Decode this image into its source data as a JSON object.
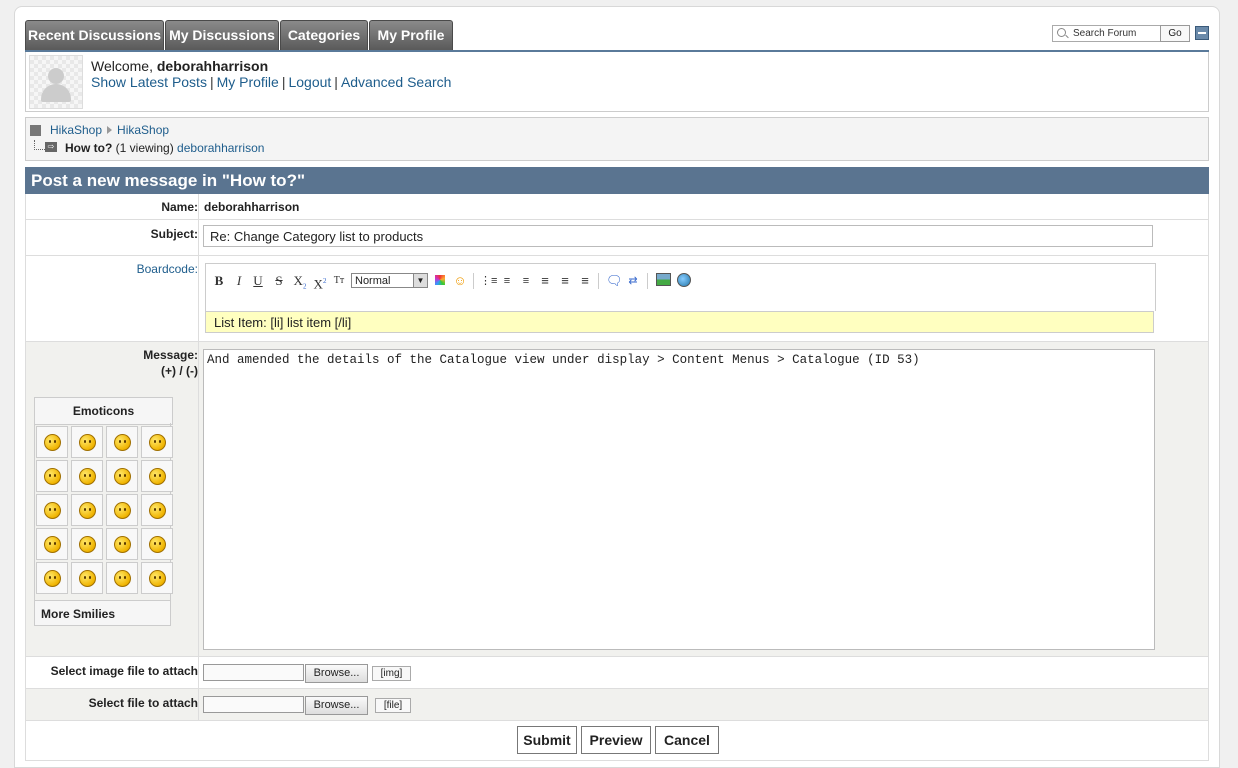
{
  "tabs": [
    "Recent Discussions",
    "My Discussions",
    "Categories",
    "My Profile"
  ],
  "search": {
    "placeholder": "Search Forum",
    "go_label": "Go"
  },
  "user": {
    "welcome_prefix": "Welcome, ",
    "username": "deborahharrison",
    "links": [
      "Show Latest Posts",
      "My Profile",
      "Logout",
      "Advanced Search"
    ]
  },
  "breadcrumb": {
    "items": [
      "HikaShop",
      "HikaShop"
    ],
    "topic": "How to?",
    "viewing": "(1 viewing)",
    "viewer": "deborahharrison"
  },
  "form": {
    "title": "Post a new message in \"How to?\"",
    "name_label": "Name:",
    "name_value": "deborahharrison",
    "subject_label": "Subject:",
    "subject_value": "Re: Change Category list to products",
    "boardcode_label": "Boardcode:",
    "font_size_value": "Normal",
    "help_text": "List Item: [li] list item [/li]",
    "message_label": "Message:",
    "message_resize": "(+) / (-)",
    "message_value": "And amended the details of the Catalogue view under display > Content Menus > Catalogue (ID 53)",
    "emoticons_label": "Emoticons",
    "more_smilies_label": "More Smilies",
    "image_attach_label": "Select image file to attach",
    "file_attach_label": "Select file to attach",
    "browse_label": "Browse...",
    "img_tag": "[img]",
    "file_tag": "[file]"
  },
  "buttons": {
    "submit": "Submit",
    "preview": "Preview",
    "cancel": "Cancel"
  },
  "toolbar_icons": [
    "bold-icon",
    "italic-icon",
    "underline-icon",
    "strikethrough-icon",
    "subscript-icon",
    "superscript-icon",
    "typeface-icon",
    "color-palette-icon",
    "spoiler-icon",
    "unordered-list-icon",
    "ordered-list-icon",
    "list-item-icon",
    "align-left-icon",
    "align-center-icon",
    "align-right-icon",
    "quote-icon",
    "code-icon",
    "image-link-icon",
    "link-icon"
  ],
  "colors": {
    "header_bar": "#5a7490",
    "tab_bg": "#6e6e6e",
    "link": "#1e5d8c",
    "help_bg": "#ffffc0"
  }
}
